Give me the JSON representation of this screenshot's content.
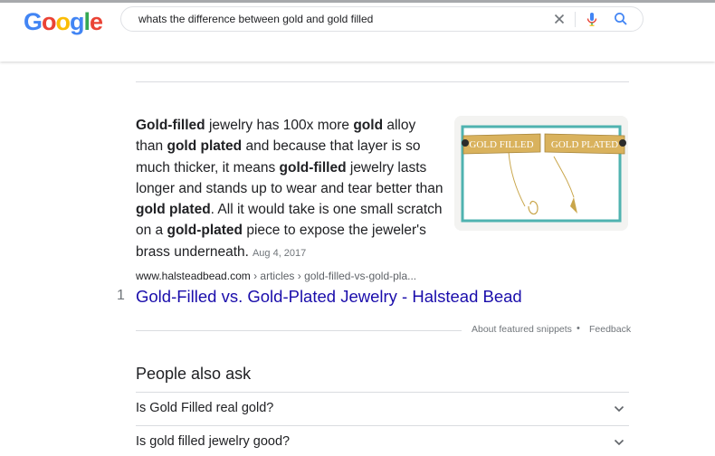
{
  "header": {
    "logo_text": "Google",
    "search": {
      "query": "whats the difference between gold and gold filled"
    }
  },
  "featured_snippet": {
    "segments": [
      {
        "text": "Gold-filled",
        "bold": true
      },
      {
        "text": " jewelry has 100x more ",
        "bold": false
      },
      {
        "text": "gold",
        "bold": true
      },
      {
        "text": " alloy than ",
        "bold": false
      },
      {
        "text": "gold plated",
        "bold": true
      },
      {
        "text": " and because that layer is so much thicker, it means ",
        "bold": false
      },
      {
        "text": "gold-filled",
        "bold": true
      },
      {
        "text": " jewelry lasts longer and stands up to wear and tear better than ",
        "bold": false
      },
      {
        "text": "gold plated",
        "bold": true
      },
      {
        "text": ". All it would take is one small scratch on a ",
        "bold": false
      },
      {
        "text": "gold-plated",
        "bold": true
      },
      {
        "text": " piece to expose the jeweler's brass underneath.",
        "bold": false
      }
    ],
    "date": "Aug 4, 2017",
    "image": {
      "banner_left": "GOLD FILLED",
      "banner_right": "GOLD PLATED"
    },
    "cite_domain": "www.halsteadbead.com",
    "cite_path": " › articles › gold-filled-vs-gold-pla...",
    "rank": "1",
    "title": "Gold-Filled vs. Gold-Plated Jewelry - Halstead Bead",
    "about_label": "About featured snippets",
    "separator": "•",
    "feedback_label": "Feedback"
  },
  "people_also_ask": {
    "title": "People also ask",
    "questions": [
      "Is Gold Filled real gold?",
      "Is gold filled jewelry good?"
    ]
  },
  "colors": {
    "link": "#1a0dab",
    "text": "#202124",
    "muted": "#70757a"
  }
}
